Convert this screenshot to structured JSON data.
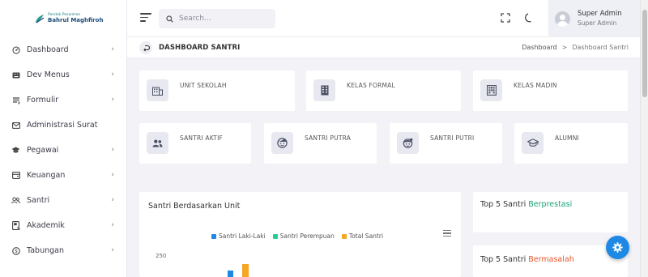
{
  "brand": {
    "line1": "Pondok Pesantren",
    "line2": "Bahrul Maghfiroh"
  },
  "sidebar": {
    "items": [
      {
        "label": "Dashboard",
        "icon": "dashboard-icon",
        "has_chevron": true
      },
      {
        "label": "Dev Menus",
        "icon": "keyboard-icon",
        "has_chevron": true
      },
      {
        "label": "Formulir",
        "icon": "form-icon",
        "has_chevron": true
      },
      {
        "label": "Administrasi Surat",
        "icon": "mail-icon",
        "has_chevron": false
      },
      {
        "label": "Pegawai",
        "icon": "graduation-cap-icon",
        "has_chevron": true
      },
      {
        "label": "Keuangan",
        "icon": "wallet-icon",
        "has_chevron": true
      },
      {
        "label": "Santri",
        "icon": "users-icon",
        "has_chevron": true
      },
      {
        "label": "Akademik",
        "icon": "book-icon",
        "has_chevron": true
      },
      {
        "label": "Tabungan",
        "icon": "coin-icon",
        "has_chevron": true
      }
    ]
  },
  "topbar": {
    "search_placeholder": "Search...",
    "user_name": "Super Admin",
    "user_role": "Super Admin"
  },
  "page": {
    "title": "DASHBOARD SANTRI",
    "breadcrumb_home": "Dashboard",
    "breadcrumb_separator": ">",
    "breadcrumb_current": "Dashboard Santri"
  },
  "stats_row1": [
    {
      "label": "UNIT SEKOLAH",
      "icon": "building-icon"
    },
    {
      "label": "KELAS FORMAL",
      "icon": "office-building-icon"
    },
    {
      "label": "KELAS MADIN",
      "icon": "apartment-icon"
    }
  ],
  "stats_row2": [
    {
      "label": "SANTRI AKTIF",
      "icon": "people-icon"
    },
    {
      "label": "SANTRI PUTRA",
      "icon": "face-icon"
    },
    {
      "label": "SANTRI PUTRI",
      "icon": "face-female-icon"
    },
    {
      "label": "ALUMNI",
      "icon": "graduation-cap-icon"
    }
  ],
  "chart_panel": {
    "title": "Santri Berdasarkan Unit"
  },
  "chart_data": {
    "type": "bar",
    "series": [
      {
        "name": "Santri Laki-Laki",
        "color": "#1e88e5"
      },
      {
        "name": "Santri Perempuan",
        "color": "#1fd28f"
      },
      {
        "name": "Total Santri",
        "color": "#f5a623"
      }
    ],
    "ytick_top": "250"
  },
  "right_panels": {
    "prestasi": {
      "prefix": "Top 5 Santri ",
      "highlight": "Berprestasi",
      "color": "#1aa37a"
    },
    "masalah": {
      "prefix": "Top 5 Santri ",
      "highlight": "Bermasalah",
      "color": "#e8542c"
    }
  },
  "colors": {
    "accent_blue": "#1e88e5"
  }
}
